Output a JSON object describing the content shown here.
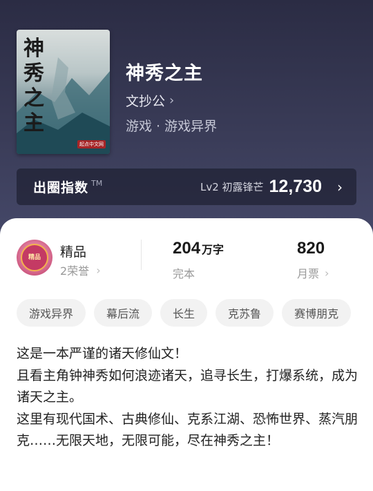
{
  "book": {
    "cover_title": "神秀之主",
    "cover_publisher": "起点中文网",
    "title": "神秀之主",
    "author": "文抄公",
    "genre": "游戏 · 游戏异界"
  },
  "index": {
    "label": "出圈指数",
    "tm": "TM",
    "level": "Lv2 初露锋芒",
    "value": "12,730"
  },
  "stats": {
    "badge_text": "精品",
    "quality_label": "精品",
    "honor": "2荣誉",
    "words_num": "204",
    "words_unit": "万字",
    "status": "完本",
    "tickets_num": "820",
    "tickets_label": "月票"
  },
  "tags": [
    "游戏异界",
    "幕后流",
    "长生",
    "克苏鲁",
    "赛博朋克"
  ],
  "description": [
    "这是一本严谨的诸天修仙文！",
    "且看主角钟神秀如何浪迹诸天，追寻长生，打爆系统，成为诸天之主。",
    "这里有现代国术、古典修仙、克系江湖、恐怖世界、蒸汽朋克……无限天地，无限可能，尽在神秀之主！"
  ],
  "colors": {
    "header_bg": "#2b2c44",
    "accent": "#ffffff"
  }
}
